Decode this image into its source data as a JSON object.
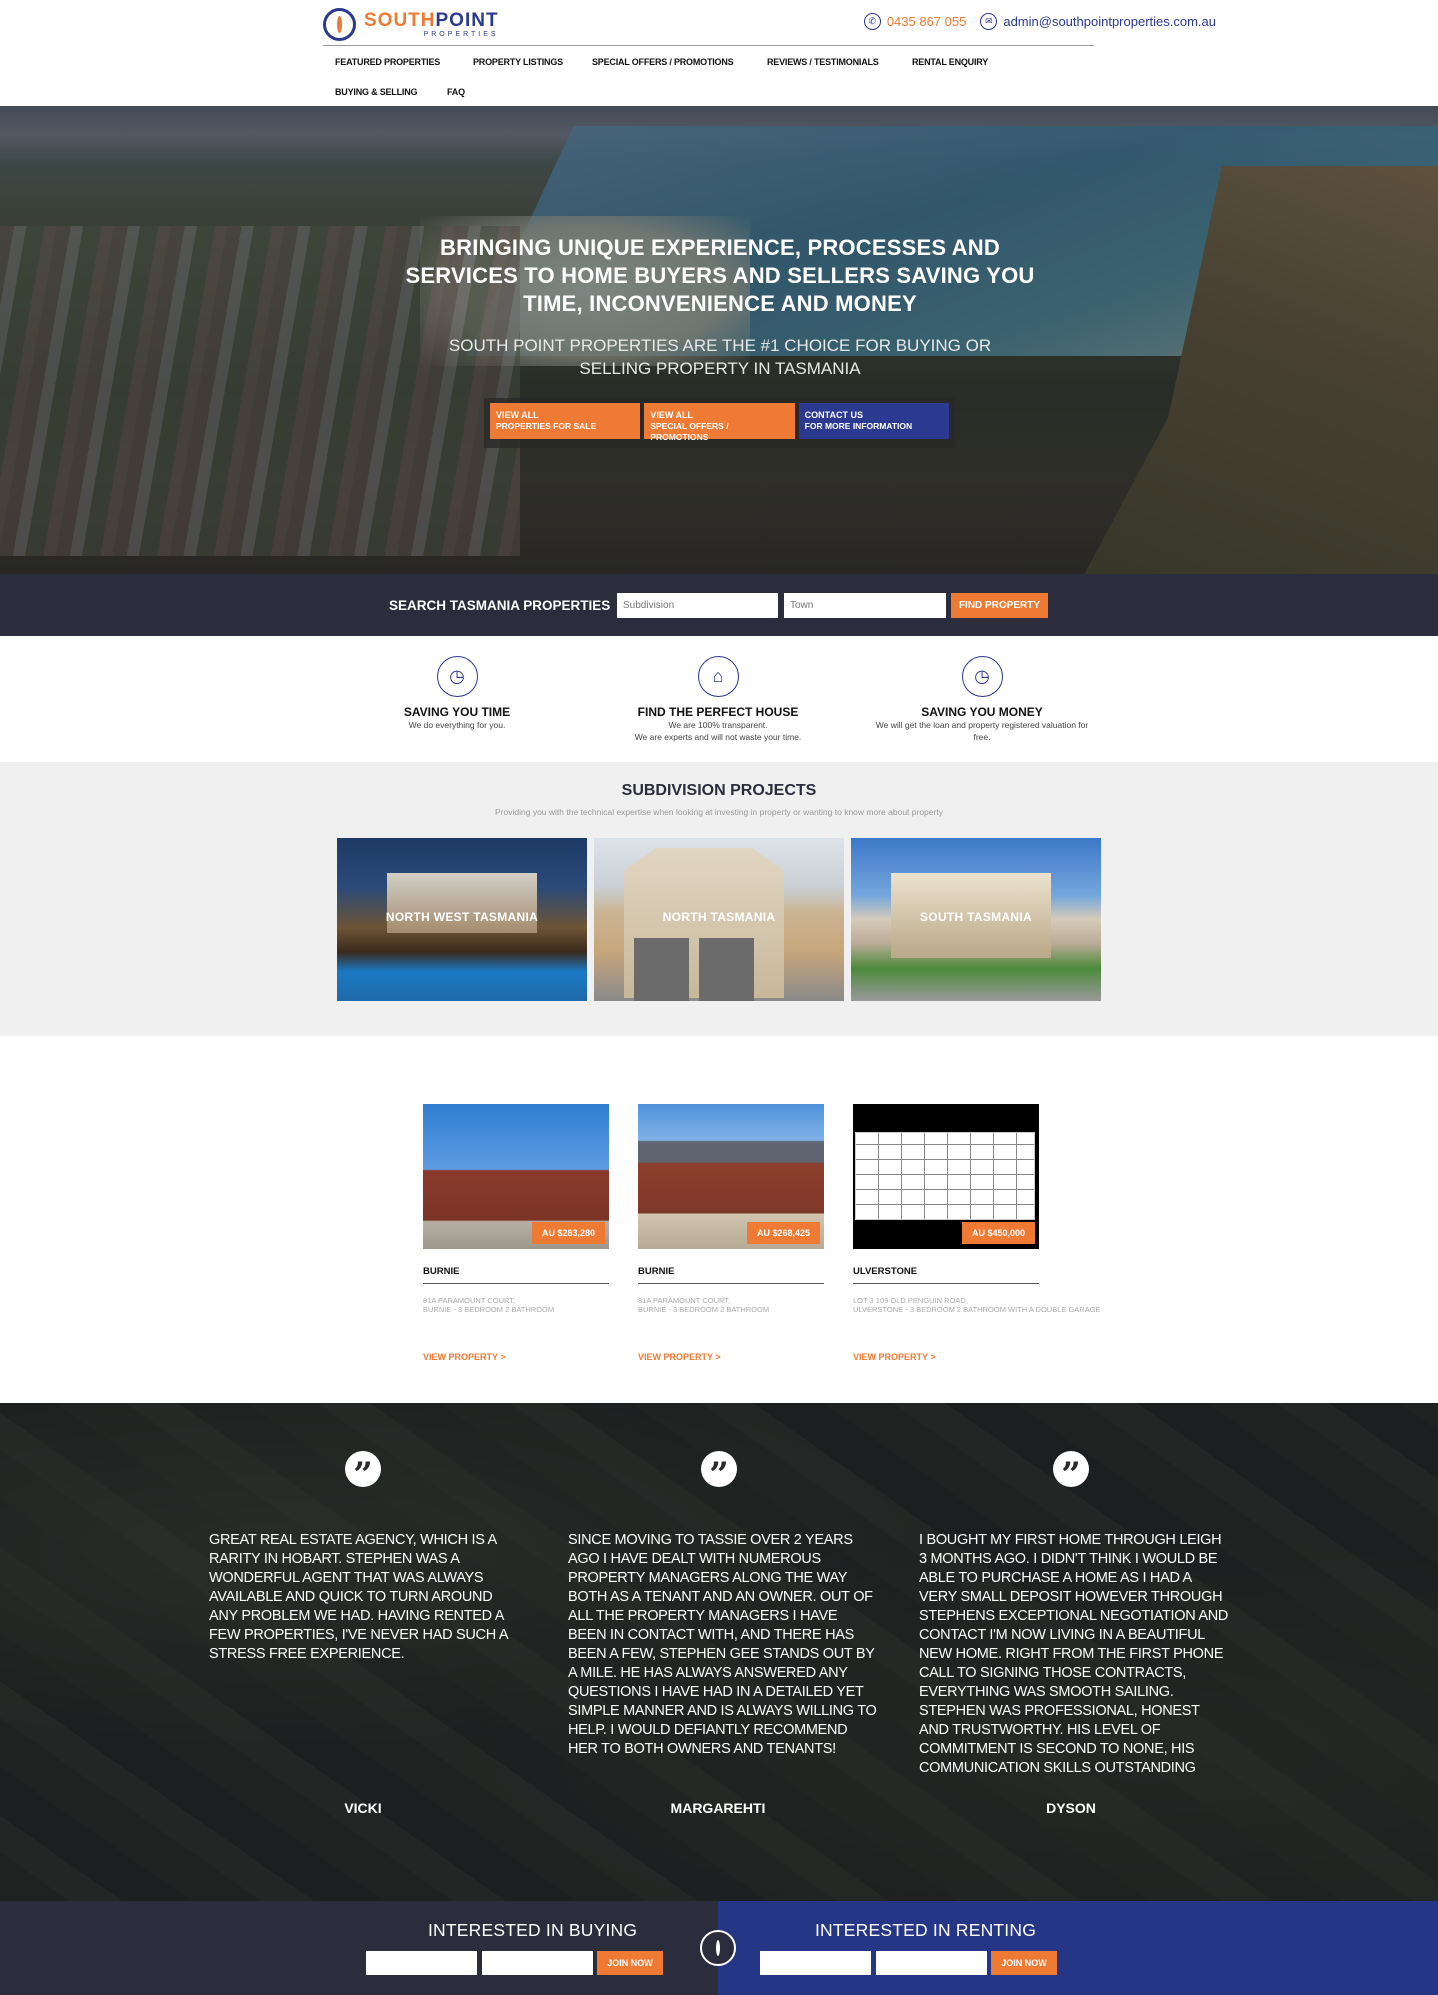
{
  "brand": {
    "south": "SOUTH",
    "point": "POINT",
    "sub": "PROPERTIES"
  },
  "contact": {
    "phone": "0435 867 055",
    "email": "admin@southpointproperties.com.au"
  },
  "nav": [
    "FEATURED PROPERTIES",
    "PROPERTY LISTINGS",
    "SPECIAL OFFERS / PROMOTIONS",
    "REVIEWS / TESTIMONIALS",
    "RENTAL ENQUIRY",
    "BUYING & SELLING",
    "FAQ"
  ],
  "hero": {
    "title": "BRINGING UNIQUE EXPERIENCE, PROCESSES AND SERVICES TO HOME BUYERS AND SELLERS SAVING YOU TIME, INCONVENIENCE AND MONEY",
    "subtitle": "SOUTH POINT PROPERTIES ARE THE #1 CHOICE FOR BUYING OR SELLING PROPERTY IN TASMANIA",
    "buttons": [
      {
        "top": "VIEW ALL",
        "bottom": "PROPERTIES FOR SALE"
      },
      {
        "top": "VIEW ALL",
        "bottom": "SPECIAL OFFERS / PROMOTIONS"
      },
      {
        "top": "CONTACT US",
        "bottom": "FOR MORE INFORMATION"
      }
    ]
  },
  "search": {
    "label": "SEARCH TASMANIA PROPERTIES",
    "subdivision_placeholder": "Subdivision",
    "town_placeholder": "Town",
    "button": "FIND PROPERTY"
  },
  "features": [
    {
      "title": "SAVING YOU TIME",
      "line1": "We do everything for you.",
      "line2": ""
    },
    {
      "title": "FIND THE PERFECT HOUSE",
      "line1": "We are 100% transparent.",
      "line2": "We are experts and will not waste your time."
    },
    {
      "title": "SAVING YOU MONEY",
      "line1": "We will get the loan and property registered valuation for",
      "line2": "free."
    }
  ],
  "subdivision": {
    "title": "SUBDIVISION PROJECTS",
    "desc": "Providing you with the technical expertise when looking at investing in property or wanting to know more about property",
    "projects": [
      "NORTH WEST TASMANIA",
      "NORTH TASMANIA",
      "SOUTH TASMANIA"
    ]
  },
  "listings": [
    {
      "price": "AU $283,280",
      "town": "BURNIE",
      "addr1": "81A PARAMOUNT COURT,",
      "addr2": "BURNIE - 3 BEDROOM 2 BATHROOM",
      "link": "VIEW PROPERTY >"
    },
    {
      "price": "AU $268,425",
      "town": "BURNIE",
      "addr1": "81A PARAMOUNT COURT,",
      "addr2": "BURNIE - 3 BEDROOM 2 BATHROOM",
      "link": "VIEW PROPERTY >"
    },
    {
      "price": "AU $450,000",
      "town": "ULVERSTONE",
      "addr1": "LOT 3 109 OLD PENGUIN ROAD,",
      "addr2": "ULVERSTONE - 3 BEDROOM 2 BATHROOM WITH A DOUBLE GARAGE",
      "link": "VIEW PROPERTY >"
    }
  ],
  "testimonials": [
    {
      "text": "GREAT REAL ESTATE AGENCY, WHICH IS A RARITY IN HOBART. STEPHEN WAS A WONDERFUL AGENT THAT WAS ALWAYS AVAILABLE AND QUICK TO TURN AROUND ANY PROBLEM WE HAD. HAVING RENTED A FEW PROPERTIES, I'VE NEVER HAD SUCH A STRESS FREE EXPERIENCE.",
      "name": "VICKI"
    },
    {
      "text": "SINCE MOVING TO TASSIE OVER 2 YEARS AGO I HAVE DEALT WITH NUMEROUS PROPERTY MANAGERS ALONG THE WAY BOTH AS A TENANT AND AN OWNER. OUT OF ALL THE PROPERTY MANAGERS I HAVE BEEN IN CONTACT WITH, AND THERE HAS BEEN A FEW, STEPHEN GEE STANDS OUT BY A MILE. HE HAS ALWAYS ANSWERED ANY QUESTIONS I HAVE HAD IN A DETAILED YET SIMPLE MANNER AND IS ALWAYS WILLING TO HELP. I WOULD DEFIANTLY RECOMMEND HER TO BOTH OWNERS AND TENANTS!",
      "name": "MARGAREHTI"
    },
    {
      "text": "I BOUGHT MY FIRST HOME THROUGH LEIGH 3 MONTHS AGO. I DIDN'T THINK I WOULD BE ABLE TO PURCHASE A HOME AS I HAD A VERY SMALL DEPOSIT HOWEVER THROUGH STEPHENS EXCEPTIONAL NEGOTIATION AND CONTACT I'M NOW LIVING IN A BEAUTIFUL NEW HOME.  RIGHT FROM THE FIRST PHONE CALL TO SIGNING THOSE CONTRACTS, EVERYTHING WAS SMOOTH SAILING. STEPHEN WAS PROFESSIONAL, HONEST AND TRUSTWORTHY. HIS LEVEL OF COMMITMENT IS SECOND TO NONE, HIS COMMUNICATION SKILLS OUTSTANDING",
      "name": "DYSON"
    }
  ],
  "footer": {
    "buying_title": "INTERESTED IN BUYING",
    "renting_title": "INTERESTED IN RENTING",
    "join_label": "JOIN NOW"
  },
  "colors": {
    "accent": "#ee7a33",
    "brand_blue": "#2b3990",
    "dark": "#2b2d3c"
  }
}
